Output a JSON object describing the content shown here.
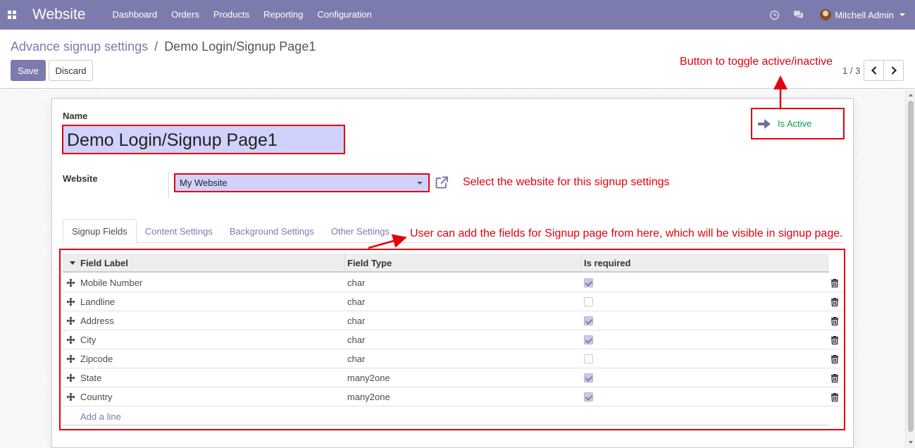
{
  "navbar": {
    "brand": "Website",
    "menu": [
      "Dashboard",
      "Orders",
      "Products",
      "Reporting",
      "Configuration"
    ],
    "user_name": "Mitchell Admin"
  },
  "control_panel": {
    "breadcrumb_parent": "Advance signup settings",
    "breadcrumb_separator": "/",
    "breadcrumb_current": "Demo Login/Signup Page1",
    "save_label": "Save",
    "discard_label": "Discard",
    "pager": "1 / 3"
  },
  "form": {
    "name_label": "Name",
    "name_value": "Demo Login/Signup Page1",
    "active_label": "Is Active",
    "website_label": "Website",
    "website_value": "My Website"
  },
  "annotations": {
    "toggle": "Button to toggle active/inactive",
    "website": "Select the website for this signup settings",
    "fields": "User can add the fields for Signup page from here, which will be visible in signup page."
  },
  "tabs": [
    "Signup Fields",
    "Content Settings",
    "Background Settings",
    "Other Settings"
  ],
  "table": {
    "columns": [
      "Field Label",
      "Field Type",
      "Is required"
    ],
    "rows": [
      {
        "label": "Mobile Number",
        "type": "char",
        "required": true
      },
      {
        "label": "Landline",
        "type": "char",
        "required": false
      },
      {
        "label": "Address",
        "type": "char",
        "required": true
      },
      {
        "label": "City",
        "type": "char",
        "required": true
      },
      {
        "label": "Zipcode",
        "type": "char",
        "required": false
      },
      {
        "label": "State",
        "type": "many2one",
        "required": true
      },
      {
        "label": "Country",
        "type": "many2one",
        "required": true
      }
    ],
    "add_line": "Add a line"
  },
  "colors": {
    "brand": "#7c7bad",
    "annotation": "#e3000f",
    "active": "#00a04a",
    "highlight": "#d0d2fb"
  },
  "icons": [
    "apps-icon",
    "clock-icon",
    "chat-icon",
    "arrow-right-icon",
    "external-link-icon",
    "move-handle-icon",
    "trash-icon",
    "chevron-left-icon",
    "chevron-right-icon"
  ]
}
